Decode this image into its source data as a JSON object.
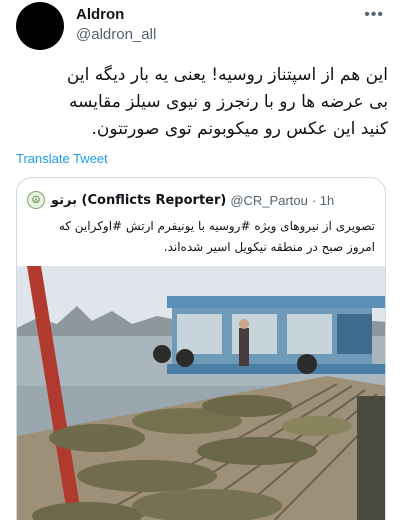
{
  "author": {
    "name": "Aldron",
    "handle": "@aldron_all"
  },
  "tweet": {
    "text_lines": [
      "این هم از اسپتناز روسیه! یعنی یه بار دیگه این",
      "بی عرضه ها رو با رنجرز و نیوی سیلز مقایسه",
      "کنید این عکس رو میکوبونم توی صورتتون."
    ],
    "translate_label": "Translate Tweet"
  },
  "quoted": {
    "name": "برتو (Conflicts Reporter)",
    "handle": "@CR_Partou",
    "time": "· 1h",
    "text_lines": [
      "تصویری از نیروهای ویژه #روسیه با یونیفرم ارتش #اوکراین که",
      "امروز صبح در منطقه نیکویل اسیر شده‌اند."
    ],
    "image_alt": "photo"
  },
  "icons": {
    "more": "more-horizontal-icon",
    "quoted_avatar": "reporter-logo-icon"
  }
}
